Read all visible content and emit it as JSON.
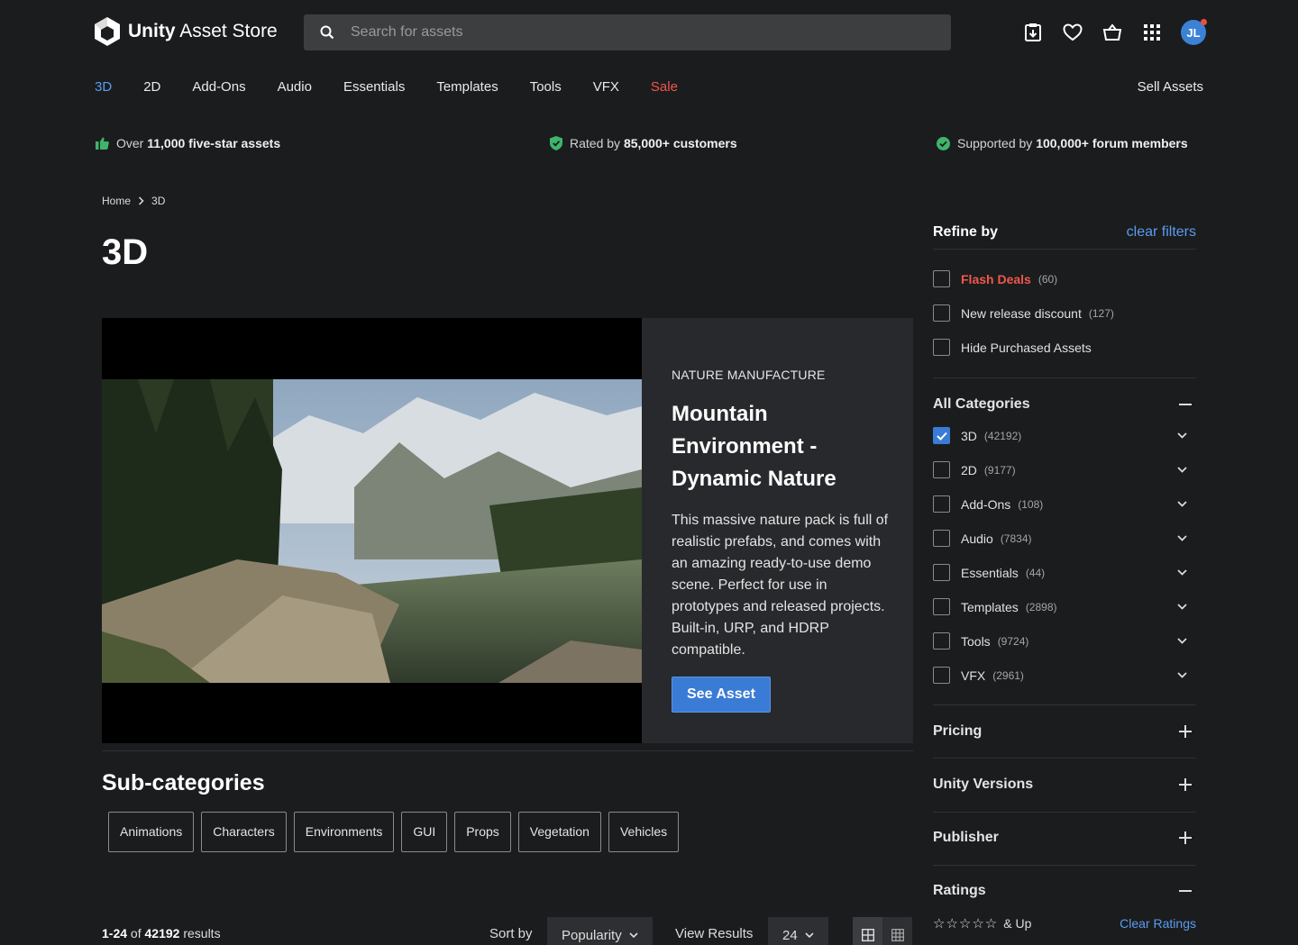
{
  "header": {
    "logo_bold": "Unity",
    "logo_rest": "Asset Store",
    "search_placeholder": "Search for assets",
    "avatar_initials": "JL"
  },
  "nav": {
    "items": [
      "3D",
      "2D",
      "Add-Ons",
      "Audio",
      "Essentials",
      "Templates",
      "Tools",
      "VFX",
      "Sale"
    ],
    "active": "3D",
    "sell": "Sell Assets"
  },
  "trust": {
    "t1_pre": "Over",
    "t1_bold": "11,000 five-star assets",
    "t2_pre": "Rated by",
    "t2_bold": "85,000+ customers",
    "t3_pre": "Supported by",
    "t3_bold": "100,000+ forum members",
    "accent_green": "#3fb46a"
  },
  "breadcrumb": {
    "home": "Home",
    "current": "3D"
  },
  "page_title": "3D",
  "hero": {
    "publisher": "NATURE MANUFACTURE",
    "title": "Mountain Environment - Dynamic Nature",
    "description": "This massive nature pack is full of realistic prefabs, and comes with an amazing ready-to-use demo scene. Perfect for use in prototypes and released projects. Built-in, URP, and HDRP compatible.",
    "cta": "See Asset"
  },
  "subcategories": {
    "heading": "Sub-categories",
    "items": [
      "Animations",
      "Characters",
      "Environments",
      "GUI",
      "Props",
      "Vegetation",
      "Vehicles"
    ]
  },
  "results": {
    "range": "1-24",
    "of": "of",
    "total": "42192",
    "suffix": "results",
    "sort_label": "Sort by",
    "sort_value": "Popularity",
    "view_label": "View Results",
    "view_value": "24"
  },
  "sidebar": {
    "refine": "Refine by",
    "clear_filters": "clear filters",
    "filters": [
      {
        "label": "Flash Deals",
        "count": "(60)"
      },
      {
        "label": "New release discount",
        "count": "(127)"
      },
      {
        "label": "Hide Purchased Assets",
        "count": ""
      }
    ],
    "categories_heading": "All Categories",
    "categories": [
      {
        "label": "3D",
        "count": "(42192)",
        "checked": true
      },
      {
        "label": "2D",
        "count": "(9177)"
      },
      {
        "label": "Add-Ons",
        "count": "(108)"
      },
      {
        "label": "Audio",
        "count": "(7834)"
      },
      {
        "label": "Essentials",
        "count": "(44)"
      },
      {
        "label": "Templates",
        "count": "(2898)"
      },
      {
        "label": "Tools",
        "count": "(9724)"
      },
      {
        "label": "VFX",
        "count": "(2961)"
      }
    ],
    "pricing": "Pricing",
    "unity_versions": "Unity Versions",
    "publisher": "Publisher",
    "ratings": "Ratings",
    "ratings_stars": "☆☆☆☆☆",
    "ratings_up": "& Up",
    "clear_ratings": "Clear Ratings"
  }
}
